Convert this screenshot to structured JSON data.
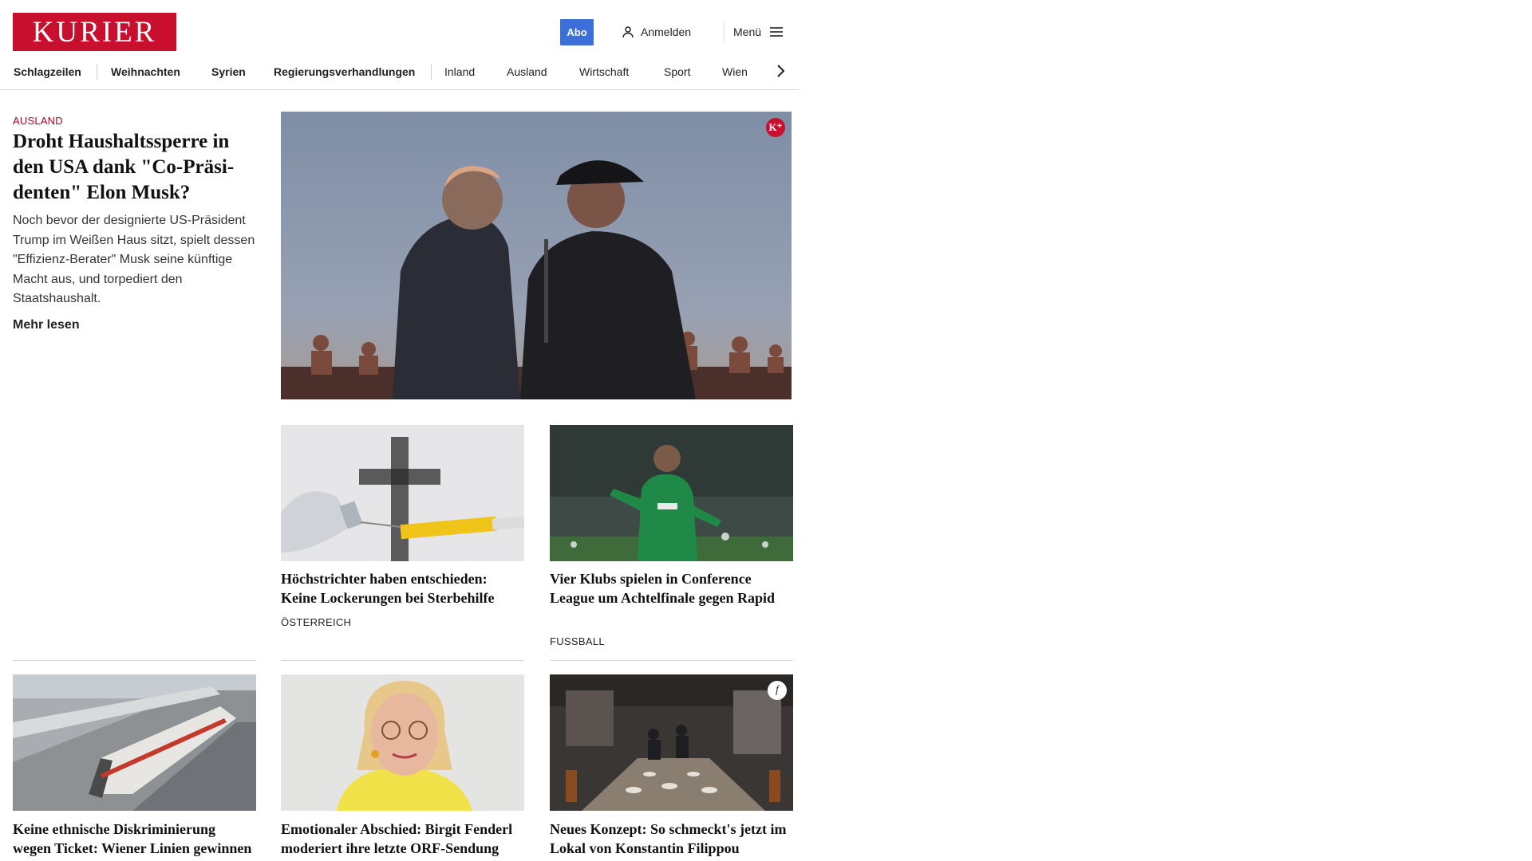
{
  "header": {
    "logo_text": "KURIER",
    "abo_label": "Abo",
    "login_label": "Anmelden",
    "menu_label": "Menü",
    "user_icon": "user-icon",
    "menu_icon": "hamburger-icon"
  },
  "nav": {
    "items": [
      "Schlagzeilen",
      "Weihnachten",
      "Syrien",
      "Regierungsverhandlungen",
      "Inland",
      "Ausland",
      "Wirtschaft",
      "Sport",
      "Wien"
    ],
    "next_icon": "chevron-right-icon"
  },
  "lead": {
    "kicker": "AUSLAND",
    "title": "Droht Haushaltssperre in den USA dank \"Co-Präsi­denten\" Elon Musk?",
    "teaser": "Noch bevor der designierte US-Präsident Trump im Weißen Haus sitzt, spielt dessen \"Effizienz-Berater\" Musk seine künftige Macht aus, und torpediert den Staatshaushalt.",
    "more_label": "Mehr lesen",
    "badge": "K⁺"
  },
  "cards": [
    {
      "title": "Höchstrichter haben entschieden: Keine Lockerungen bei Sterbehilfe",
      "kicker": "ÖSTERREICH"
    },
    {
      "title": "Vier Klubs spielen in Conference League um Achtelfinale gegen Rapid",
      "kicker": "FUSSBALL"
    },
    {
      "title": "Keine ethnische Diskriminierung wegen Ticket: Wiener Linien ge­winnen Prozess"
    },
    {
      "title": "Emotionaler Abschied: Birgit Fen­derl moderiert ihre letzte ORF-Sendung"
    },
    {
      "title": "Neues Konzept: So schmeckt's jetzt im Lokal von Konstantin Filippou",
      "badge": "f"
    }
  ],
  "colors": {
    "brand": "#c8102e",
    "abo": "#3d6fd8",
    "kicker": "#b5001f"
  }
}
